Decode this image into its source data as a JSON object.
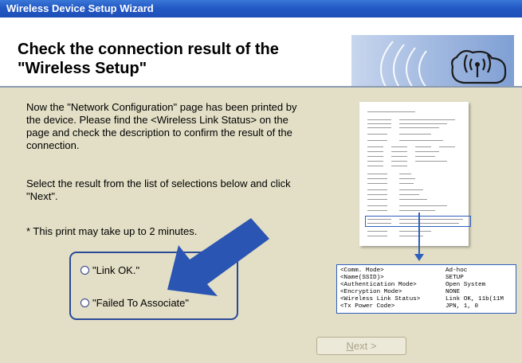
{
  "window": {
    "title": "Wireless Device Setup Wizard"
  },
  "header": {
    "title": "Check the connection result of the\n\"Wireless Setup\""
  },
  "instructions": {
    "paragraph1": "Now the \"Network Configuration\" page has been printed by the device. Please find the <Wireless Link Status> on the page and check the description to confirm the result of the connection.",
    "paragraph2": "Select the result from the list of selections below and click \"Next\".",
    "note": "* This print may take up to 2 minutes."
  },
  "options": [
    {
      "label": "\"Link OK.\"",
      "selected": false
    },
    {
      "label": "\"Failed To Associate\"",
      "selected": false
    }
  ],
  "status_detail": [
    {
      "key": "<Comm. Mode>",
      "value": "Ad-hoc"
    },
    {
      "key": "<Name(SSID)>",
      "value": "SETUP"
    },
    {
      "key": "<Authentication Mode>",
      "value": "Open System"
    },
    {
      "key": "<Encryption Mode>",
      "value": "NONE"
    },
    {
      "key": "<Wireless Link Status>",
      "value": "Link OK, 11b(11M"
    },
    {
      "key": "<Tx Power Code>",
      "value": "JPN, 1, 0"
    }
  ],
  "buttons": {
    "next_mnemonic": "N",
    "next_rest": "ext >",
    "next_enabled": false
  },
  "colors": {
    "titlebar": "#2359c4",
    "content_bg": "#e3dfc6",
    "accent": "#2a4a98",
    "arrow": "#2b55b3"
  },
  "icons": {
    "logo": "wireless-signal-icon"
  }
}
